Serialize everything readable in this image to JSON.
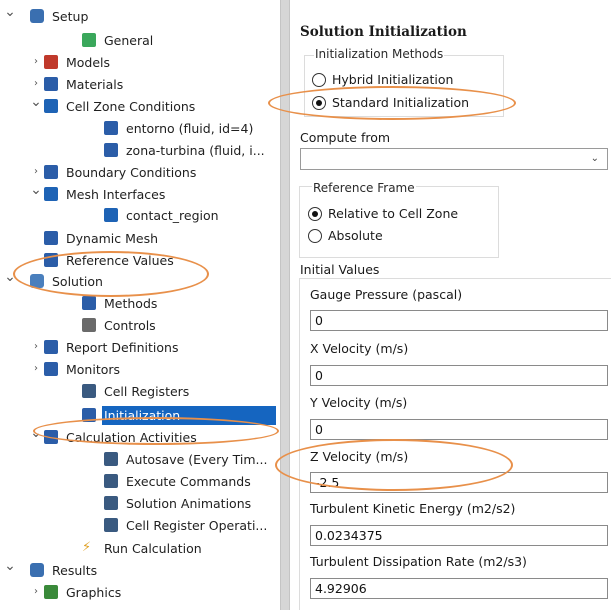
{
  "tree": {
    "items": [
      {
        "label": "Setup",
        "expander": "v",
        "icon": "setup-folder-icon"
      },
      {
        "label": "General",
        "expander": "",
        "icon": "general-icon"
      },
      {
        "label": "Models",
        "expander": ">",
        "icon": "models-icon"
      },
      {
        "label": "Materials",
        "expander": ">",
        "icon": "materials-icon"
      },
      {
        "label": "Cell Zone Conditions",
        "expander": "v",
        "icon": "cell-zone-icon"
      },
      {
        "label": "entorno (fluid, id=4)",
        "expander": "",
        "icon": "fluid-zone-icon"
      },
      {
        "label": "zona-turbina (fluid, i...",
        "expander": "",
        "icon": "fluid-zone-icon"
      },
      {
        "label": "Boundary Conditions",
        "expander": ">",
        "icon": "boundary-icon"
      },
      {
        "label": "Mesh Interfaces",
        "expander": "v",
        "icon": "mesh-interface-icon"
      },
      {
        "label": "contact_region",
        "expander": "",
        "icon": "interface-item-icon"
      },
      {
        "label": "Dynamic Mesh",
        "expander": "",
        "icon": "dynamic-mesh-icon"
      },
      {
        "label": "Reference Values",
        "expander": "",
        "icon": "reference-values-icon"
      },
      {
        "label": "Solution",
        "expander": "v",
        "icon": "solution-folder-icon"
      },
      {
        "label": "Methods",
        "expander": "",
        "icon": "methods-icon"
      },
      {
        "label": "Controls",
        "expander": "",
        "icon": "controls-icon"
      },
      {
        "label": "Report Definitions",
        "expander": ">",
        "icon": "report-icon"
      },
      {
        "label": "Monitors",
        "expander": ">",
        "icon": "monitors-icon"
      },
      {
        "label": "Cell Registers",
        "expander": "",
        "icon": "cell-registers-icon"
      },
      {
        "label": "Initialization",
        "expander": "",
        "icon": "initialization-icon",
        "selected": true
      },
      {
        "label": "Calculation Activities",
        "expander": "v",
        "icon": "calc-activities-icon"
      },
      {
        "label": "Autosave (Every Tim...",
        "expander": "",
        "icon": "autosave-icon"
      },
      {
        "label": "Execute Commands",
        "expander": "",
        "icon": "execute-icon"
      },
      {
        "label": "Solution Animations",
        "expander": "",
        "icon": "animation-icon"
      },
      {
        "label": "Cell Register Operati...",
        "expander": "",
        "icon": "register-op-icon"
      },
      {
        "label": "Run Calculation",
        "expander": "",
        "icon": "run-icon"
      },
      {
        "label": "Results",
        "expander": "v",
        "icon": "results-icon"
      },
      {
        "label": "Graphics",
        "expander": ">",
        "icon": "graphics-icon"
      }
    ]
  },
  "panel": {
    "title": "Solution Initialization",
    "init_methods": {
      "title": "Initialization Methods",
      "options": [
        "Hybrid Initialization",
        "Standard Initialization"
      ],
      "selected": "Standard Initialization"
    },
    "compute_from": {
      "label": "Compute from",
      "value": ""
    },
    "reference_frame": {
      "title": "Reference Frame",
      "options": [
        "Relative to Cell Zone",
        "Absolute"
      ],
      "selected": "Relative to Cell Zone"
    },
    "initial_values": {
      "title": "Initial Values",
      "fields": [
        {
          "label": "Gauge Pressure (pascal)",
          "value": "0"
        },
        {
          "label": "X Velocity (m/s)",
          "value": "0"
        },
        {
          "label": "Y Velocity (m/s)",
          "value": "0"
        },
        {
          "label": "Z Velocity (m/s)",
          "value": "-2.5"
        },
        {
          "label": "Turbulent Kinetic Energy (m2/s2)",
          "value": "0.0234375"
        },
        {
          "label": "Turbulent Dissipation Rate (m2/s3)",
          "value": "4.92906"
        }
      ]
    }
  },
  "colors": {
    "selection": "#1565c0",
    "highlight_ellipse": "#e8904a"
  }
}
